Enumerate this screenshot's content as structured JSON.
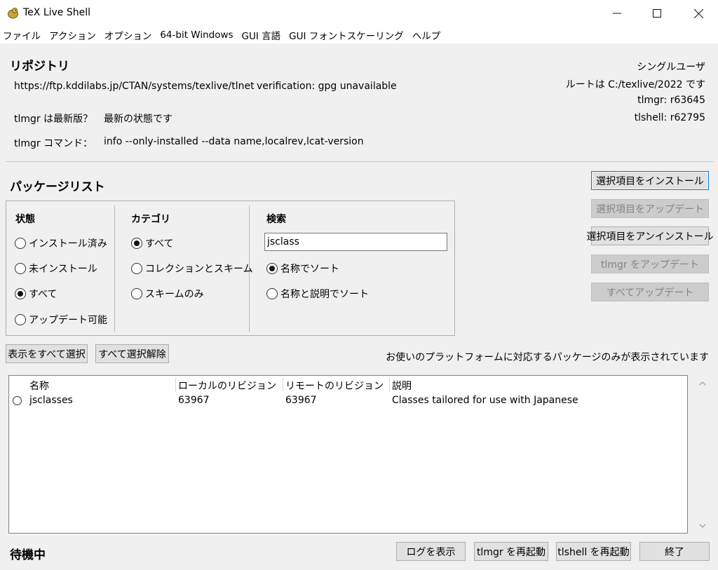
{
  "window": {
    "title": "TeX Live Shell"
  },
  "menu": [
    "ファイル",
    "アクション",
    "オプション",
    "64-bit Windows",
    "GUI 言語",
    "GUI フォントスケーリング",
    "ヘルプ"
  ],
  "repository": {
    "heading": "リポジトリ",
    "url": "https://ftp.kddilabs.jp/CTAN/systems/texlive/tlnet",
    "verification": "verification: gpg unavailable",
    "uptodate_label": "tlmgr は最新版？",
    "uptodate_value": "最新の状態です",
    "command_label": "tlmgr コマンド：",
    "command_value": "info --only-installed --data name,localrev,lcat-version"
  },
  "info": {
    "mode": "シングルユーザ",
    "root": "ルートは C:/texlive/2022 です",
    "tlmgr_rev": "tlmgr: r63645",
    "tlshell_rev": "tlshell: r62795"
  },
  "actions": {
    "install_selected": "選択項目をインストール",
    "update_selected": "選択項目をアップデート",
    "uninstall_selected": "選択項目をアンインストール",
    "update_tlmgr": "tlmgr をアップデート",
    "update_all": "すべてアップデート"
  },
  "packages": {
    "heading": "パッケージリスト",
    "status_title": "状態",
    "status_options": [
      "インストール済み",
      "未インストール",
      "すべて",
      "アップデート可能"
    ],
    "status_selected": "すべて",
    "category_title": "カテゴリ",
    "category_options": [
      "すべて",
      "コレクションとスキーム",
      "スキームのみ"
    ],
    "category_selected": "すべて",
    "search_title": "検索",
    "search_value": "jsclass",
    "sort_options": [
      "名称でソート",
      "名称と説明でソート"
    ],
    "sort_selected": "名称でソート",
    "select_all_shown": "表示をすべて選択",
    "deselect_all": "すべて選択解除",
    "platform_note": "お使いのプラットフォームに対応するパッケージのみが表示されています",
    "columns": [
      "名称",
      "ローカルのリビジョン",
      "リモートのリビジョン",
      "説明"
    ],
    "rows": [
      {
        "name": "jsclasses",
        "local_rev": "63967",
        "remote_rev": "63967",
        "description": "Classes tailored for use with Japanese"
      }
    ]
  },
  "footer": {
    "status": "待機中",
    "show_log": "ログを表示",
    "restart_tlmgr": "tlmgr を再起動",
    "restart_tlshell": "tlshell を再起動",
    "quit": "終了"
  }
}
